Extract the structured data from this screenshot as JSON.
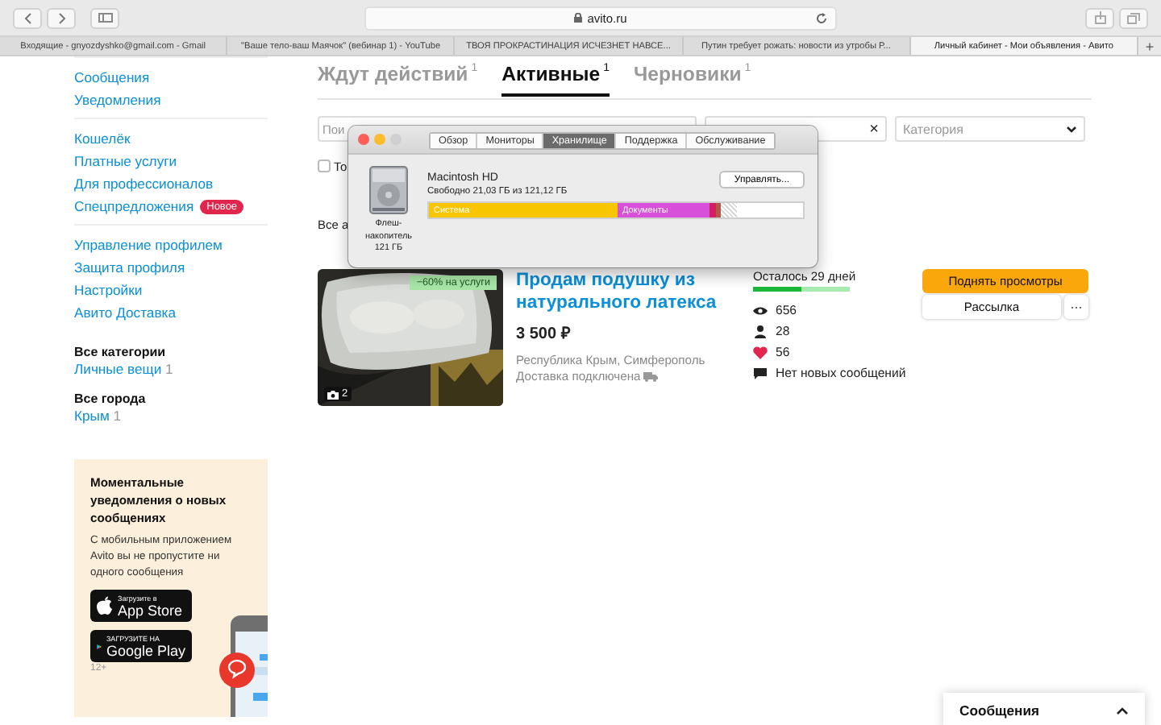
{
  "browser": {
    "address": "avito.ru",
    "tabs": [
      {
        "title": "Входящие - gnyozdyshko@gmail.com - Gmail",
        "selected": false
      },
      {
        "title": "\"Ваше тело-ваш Маячок\" (вебинар 1) - YouTube",
        "selected": false
      },
      {
        "title": "ТВОЯ ПРОКРАСТИНАЦИЯ ИСЧЕЗНЕТ НАВСЕ...",
        "selected": false
      },
      {
        "title": "Путин требует рожать: новости из утробы Р...",
        "selected": false
      },
      {
        "title": "Личный кабинет - Мои объявления - Авито",
        "selected": true
      }
    ],
    "new_tab": "+"
  },
  "sidebar": {
    "groups": [
      [
        {
          "label": "Сообщения"
        },
        {
          "label": "Уведомления"
        }
      ],
      [
        {
          "label": "Кошелёк"
        },
        {
          "label": "Платные услуги"
        },
        {
          "label": "Для профессионалов"
        },
        {
          "label": "Спецпредложения",
          "badge": "Новое"
        }
      ],
      [
        {
          "label": "Управление профилем"
        },
        {
          "label": "Защита профиля"
        },
        {
          "label": "Настройки"
        },
        {
          "label": "Авито Доставка"
        }
      ]
    ],
    "filters": [
      {
        "heading": "Все категории",
        "items": [
          {
            "label": "Личные вещи",
            "count": "1"
          }
        ]
      },
      {
        "heading": "Все города",
        "items": [
          {
            "label": "Крым",
            "count": "1"
          }
        ]
      }
    ],
    "promo": {
      "title": "Моментальные уведомления о новых сообщениях",
      "text": "С мобильным приложением Avito вы не пропустите ни одного сообщения",
      "stores": [
        {
          "kind": "apple",
          "caption": "Загрузите в",
          "name": "App Store"
        },
        {
          "kind": "google",
          "caption": "ЗАГРУЗИТЕ НА",
          "name": "Google Play"
        }
      ],
      "age": "12+"
    }
  },
  "tabs": [
    {
      "label": "Ждут действий",
      "count": "1",
      "selected": false
    },
    {
      "label": "Активные",
      "count": "1",
      "selected": true
    },
    {
      "label": "Черновики",
      "count": "1",
      "selected": false
    }
  ],
  "filters": {
    "search": {
      "placeholder": "Пои"
    },
    "second": {
      "clear": "×"
    },
    "category": {
      "placeholder": "Категория"
    },
    "checkbox": {
      "label": "То",
      "checked": false
    }
  },
  "all_label": "Все а",
  "listing": {
    "badge": "−60% на услуги",
    "photo_count": "2",
    "title": "Продам подушку из натурального латекса",
    "price": "3 500 ₽",
    "location": "Республика Крым, Симферополь",
    "delivery": "Доставка подключена",
    "remaining": {
      "text": "Осталось 29 дней",
      "level": 0.5
    },
    "stats": [
      {
        "kind": "views",
        "value": "656"
      },
      {
        "kind": "contacts",
        "value": "28"
      },
      {
        "kind": "favorites",
        "value": "56"
      },
      {
        "kind": "messages",
        "value": "Нет новых сообщений"
      }
    ],
    "actions": [
      {
        "kind": "primary",
        "label": "Поднять просмотры"
      },
      {
        "kind": "secondary",
        "label": "Рассылка"
      },
      {
        "kind": "more",
        "label": "···"
      }
    ]
  },
  "about_mac": {
    "tabs": [
      {
        "label": "Обзор",
        "selected": false
      },
      {
        "label": "Мониторы",
        "selected": false
      },
      {
        "label": "Хранилище",
        "selected": true
      },
      {
        "label": "Поддержка",
        "selected": false
      },
      {
        "label": "Обслуживание",
        "selected": false
      }
    ],
    "disk": {
      "name": "Macintosh HD",
      "free": "Свободно 21,03 ГБ из 121,12 ГБ",
      "label": "Флеш-накопитель 121 ГБ",
      "manage": "Управлять..."
    },
    "storage": [
      {
        "kind": "used",
        "label": "Система",
        "color": "#f7c600"
      },
      {
        "kind": "used",
        "label": "Документы",
        "color": "#d84fd9"
      },
      {
        "kind": "used",
        "color": "#d41f5f"
      },
      {
        "kind": "used",
        "color": "#b0584a"
      },
      {
        "kind": "purgeable"
      }
    ]
  },
  "messages_panel": {
    "title": "Сообщения",
    "expanded": false
  }
}
